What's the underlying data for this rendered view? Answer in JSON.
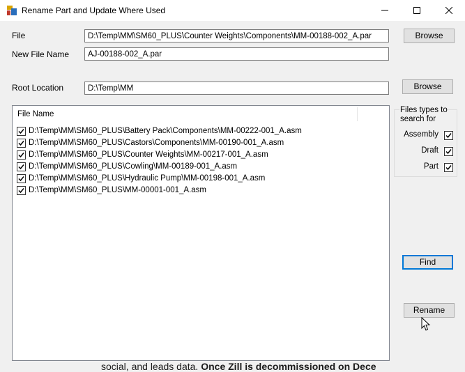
{
  "window": {
    "title": "Rename Part and Update  Where Used",
    "controls": {
      "minimize": "minimize-icon",
      "maximize": "maximize-icon",
      "close": "close-icon"
    }
  },
  "form": {
    "file_label": "File",
    "file_value": "D:\\Temp\\MM\\SM60_PLUS\\Counter Weights\\Components\\MM-00188-002_A.par",
    "new_file_name_label": "New File Name",
    "new_file_name_value": "AJ-00188-002_A.par",
    "root_location_label": "Root Location",
    "root_location_value": "D:\\Temp\\MM",
    "browse_label": "Browse",
    "browse2_label": "Browse"
  },
  "file_list": {
    "header": "File Name",
    "rows": [
      {
        "checked": true,
        "path": "D:\\Temp\\MM\\SM60_PLUS\\Battery Pack\\Components\\MM-00222-001_A.asm"
      },
      {
        "checked": true,
        "path": "D:\\Temp\\MM\\SM60_PLUS\\Castors\\Components\\MM-00190-001_A.asm"
      },
      {
        "checked": true,
        "path": "D:\\Temp\\MM\\SM60_PLUS\\Counter Weights\\MM-00217-001_A.asm"
      },
      {
        "checked": true,
        "path": "D:\\Temp\\MM\\SM60_PLUS\\Cowling\\MM-00189-001_A.asm"
      },
      {
        "checked": true,
        "path": "D:\\Temp\\MM\\SM60_PLUS\\Hydraulic Pump\\MM-00198-001_A.asm"
      },
      {
        "checked": true,
        "path": "D:\\Temp\\MM\\SM60_PLUS\\MM-00001-001_A.asm"
      }
    ]
  },
  "file_types": {
    "caption": "Files types to search for",
    "caption_line1": "Files types to",
    "caption_line2": "search for",
    "options": [
      {
        "label": "Assembly",
        "checked": true
      },
      {
        "label": "Draft",
        "checked": true
      },
      {
        "label": "Part",
        "checked": true
      }
    ]
  },
  "actions": {
    "find_label": "Find",
    "rename_label": "Rename"
  },
  "background": {
    "text_part1": "social, and leads data.",
    "text_part2": "Once Zill is decommissioned on Dece"
  },
  "colors": {
    "window_bg": "#f0f0f0",
    "titlebar_bg": "#ffffff",
    "default_button_border": "#0078d7"
  }
}
